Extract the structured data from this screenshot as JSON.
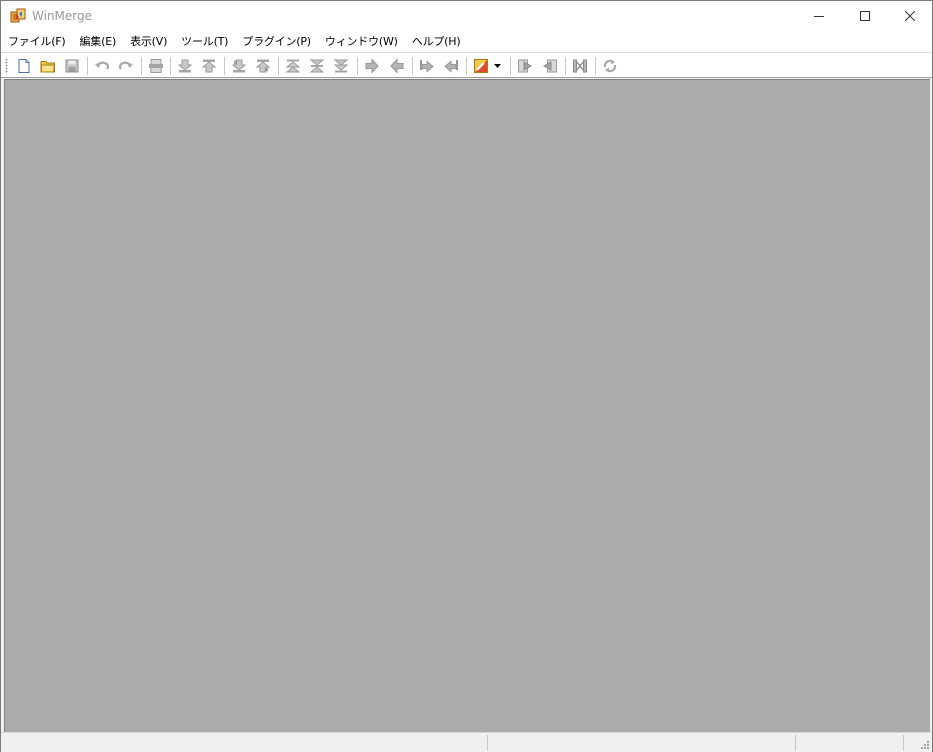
{
  "window": {
    "title": "WinMerge",
    "app_icon": "winmerge-logo-icon",
    "controls": [
      "minimize-icon",
      "maximize-icon",
      "close-icon"
    ]
  },
  "menu": {
    "items": [
      {
        "label": "ファイル(F)"
      },
      {
        "label": "編集(E)"
      },
      {
        "label": "表示(V)"
      },
      {
        "label": "ツール(T)"
      },
      {
        "label": "プラグイン(P)"
      },
      {
        "label": "ウィンドウ(W)"
      },
      {
        "label": "ヘルプ(H)"
      }
    ]
  },
  "toolbar": {
    "buttons": [
      {
        "icon": "new-document-icon",
        "enabled": true
      },
      {
        "icon": "open-folder-icon",
        "enabled": true
      },
      {
        "icon": "save-icon",
        "enabled": false
      },
      {
        "icon": "undo-icon",
        "enabled": false
      },
      {
        "icon": "redo-icon",
        "enabled": false
      },
      {
        "icon": "current-difference-icon",
        "enabled": false
      },
      {
        "icon": "next-difference-icon",
        "enabled": false
      },
      {
        "icon": "previous-difference-icon",
        "enabled": false
      },
      {
        "icon": "next-conflict-icon",
        "enabled": false
      },
      {
        "icon": "previous-conflict-icon",
        "enabled": false
      },
      {
        "icon": "first-difference-icon",
        "enabled": false
      },
      {
        "icon": "current-diff-icon",
        "enabled": false
      },
      {
        "icon": "last-difference-icon",
        "enabled": false
      },
      {
        "icon": "copy-right-icon",
        "enabled": false
      },
      {
        "icon": "copy-left-icon",
        "enabled": false
      },
      {
        "icon": "copy-right-advance-icon",
        "enabled": false
      },
      {
        "icon": "copy-left-advance-icon",
        "enabled": false
      },
      {
        "icon": "options-icon",
        "enabled": true
      },
      {
        "icon": "dropdown-arrow-icon",
        "enabled": true
      },
      {
        "icon": "copy-all-right-icon",
        "enabled": false
      },
      {
        "icon": "copy-all-left-icon",
        "enabled": false
      },
      {
        "icon": "merge-mode-icon",
        "enabled": false
      },
      {
        "icon": "refresh-icon",
        "enabled": false
      }
    ]
  },
  "colors": {
    "mdi_background": "#ababab",
    "title_inactive_text": "#999999",
    "disabled_icon": "#b4b4b4"
  }
}
